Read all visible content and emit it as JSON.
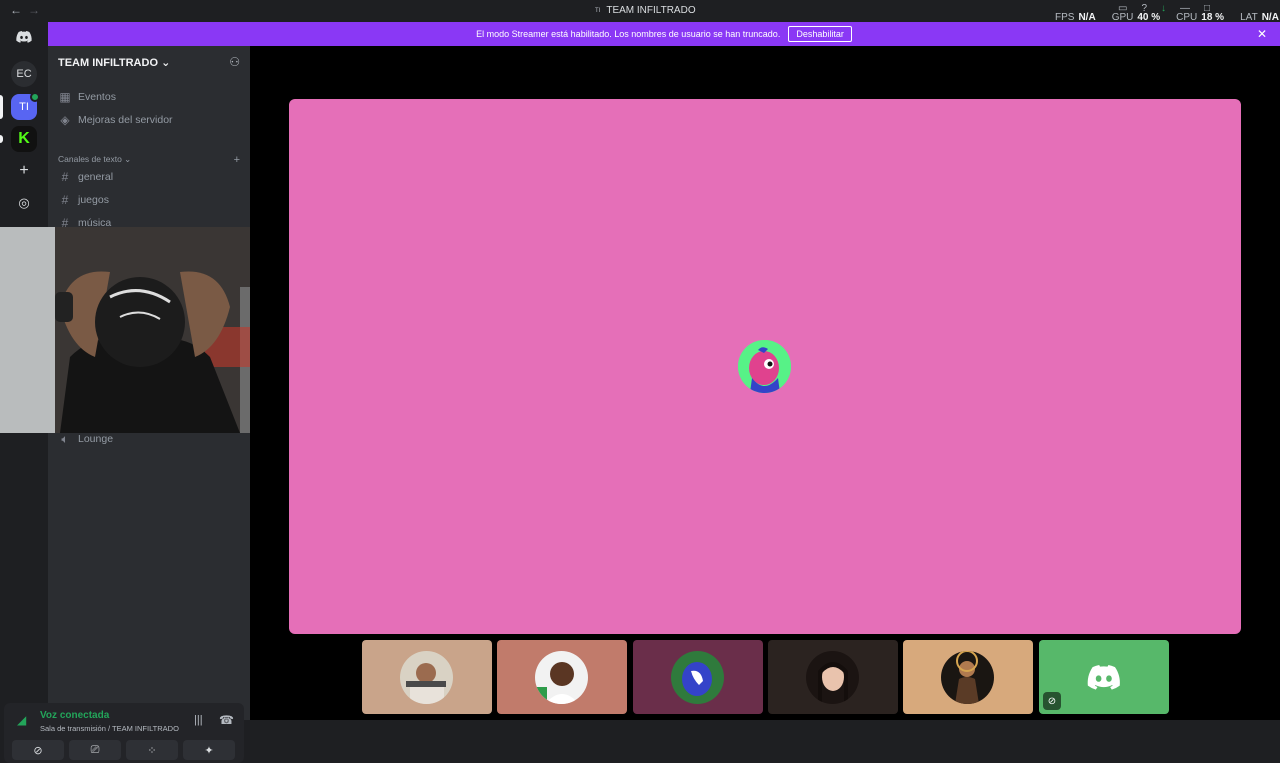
{
  "titlebar": {
    "title": "TEAM INFILTRADO",
    "server_abbr": "TI",
    "stats": [
      {
        "label": "FPS",
        "value": "N/A"
      },
      {
        "label": "GPU",
        "value": "40 %"
      },
      {
        "label": "CPU",
        "value": "18 %"
      },
      {
        "label": "LAT",
        "value": "N/A"
      }
    ]
  },
  "banner": {
    "text": "El modo Streamer está habilitado. Los nombres de usuario se han truncado.",
    "button": "Deshabilitar"
  },
  "guilds": [
    {
      "label": "",
      "icon": "discord-icon"
    },
    {
      "label": "EC"
    },
    {
      "label": "TI"
    },
    {
      "label": "K"
    },
    {
      "label": "+",
      "icon": "add-server-icon"
    },
    {
      "label": "",
      "icon": "compass-icon"
    }
  ],
  "sidebar": {
    "server_name": "TEAM INFILTRADO",
    "top_items": [
      "Eventos",
      "Mejoras del servidor"
    ],
    "text_category": "Canales de texto",
    "text_channels": [
      "general",
      "juegos",
      "música"
    ],
    "voice_channels": [
      "Lounge"
    ]
  },
  "voice_panel": {
    "status": "Voz conectada",
    "location": "Sala de transmisión / TEAM INFILTRADO"
  },
  "colors": {
    "accent": "#5865f2",
    "banner": "#8a38f5",
    "main_tile": "#e56fb8",
    "connected": "#23a55a",
    "discord_tile": "#57b86a"
  },
  "tiles": [
    {
      "name": "participant-1",
      "bg": "#c9a48a"
    },
    {
      "name": "participant-2",
      "bg": "#c17b6b"
    },
    {
      "name": "participant-3",
      "bg": "#6a2e4a"
    },
    {
      "name": "participant-4",
      "bg": "#2b2320"
    },
    {
      "name": "participant-5",
      "bg": "#d7a97c"
    },
    {
      "name": "participant-6",
      "bg": "#57b86a"
    }
  ]
}
